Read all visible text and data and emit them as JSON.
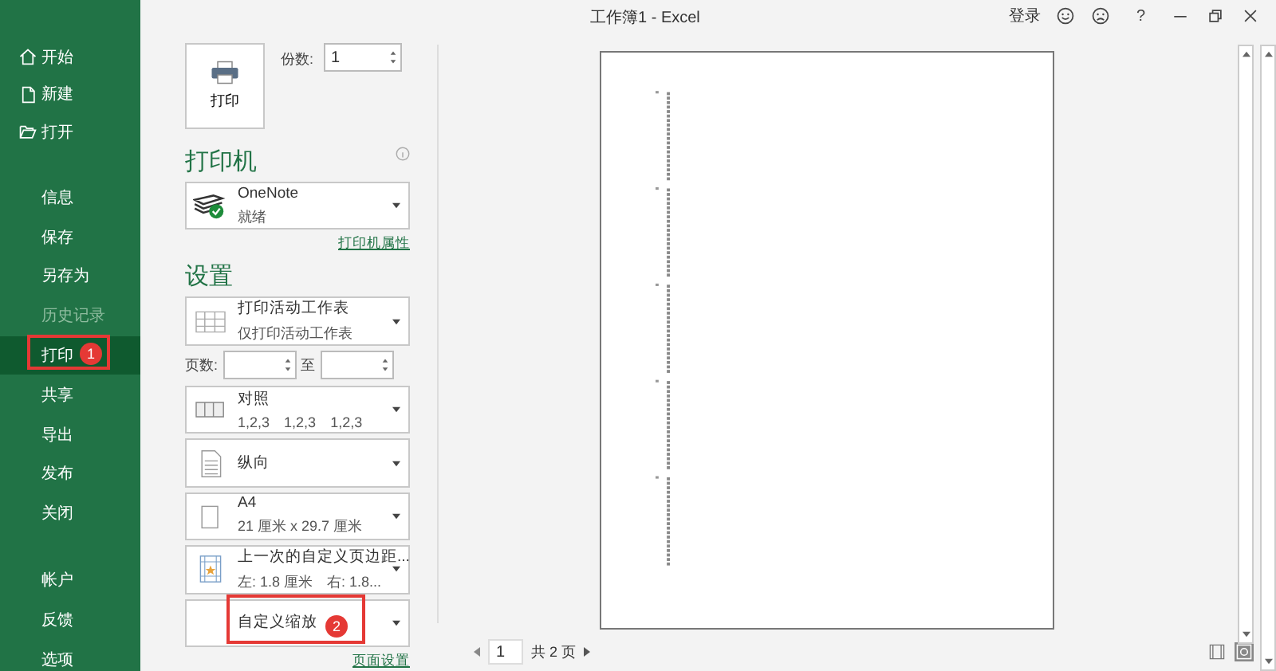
{
  "window": {
    "title": "工作簿1 - Excel",
    "sign_in": "登录",
    "help": "?"
  },
  "sidebar": {
    "items": [
      {
        "label": "开始",
        "selected": false,
        "disabled": false
      },
      {
        "label": "新建",
        "selected": false,
        "disabled": false
      },
      {
        "label": "打开",
        "selected": false,
        "disabled": false
      },
      {
        "label": "信息",
        "selected": false,
        "disabled": false
      },
      {
        "label": "保存",
        "selected": false,
        "disabled": false
      },
      {
        "label": "另存为",
        "selected": false,
        "disabled": false
      },
      {
        "label": "历史记录",
        "selected": false,
        "disabled": true
      },
      {
        "label": "打印",
        "selected": true,
        "disabled": false,
        "callout": "1"
      },
      {
        "label": "共享",
        "selected": false,
        "disabled": false
      },
      {
        "label": "导出",
        "selected": false,
        "disabled": false
      },
      {
        "label": "发布",
        "selected": false,
        "disabled": false
      },
      {
        "label": "关闭",
        "selected": false,
        "disabled": false
      },
      {
        "label": "帐户",
        "selected": false,
        "disabled": false
      },
      {
        "label": "反馈",
        "selected": false,
        "disabled": false
      },
      {
        "label": "选项",
        "selected": false,
        "disabled": false
      }
    ]
  },
  "print": {
    "button": "打印",
    "copies_label": "份数:",
    "copies": "1"
  },
  "printer": {
    "heading": "打印机",
    "name": "OneNote",
    "status": "就绪",
    "properties_link": "打印机属性"
  },
  "settings": {
    "heading": "设置",
    "pages_label": "页数:",
    "to_label": "至",
    "page_setup_link": "页面设置",
    "dropdowns": [
      {
        "kind": "sheet",
        "title": "打印活动工作表",
        "subtitle": "仅打印活动工作表"
      },
      {
        "kind": "collate",
        "title": "对照",
        "parts": [
          "1,2,3",
          "1,2,3",
          "1,2,3"
        ]
      },
      {
        "kind": "portrait",
        "title": "纵向"
      },
      {
        "kind": "paper",
        "title": "A4",
        "subtitle": "21 厘米 x 29.7 厘米"
      },
      {
        "kind": "margins",
        "title": "上一次的自定义页边距...",
        "parts": [
          "左:  1.8 厘米",
          "右:  1.8..."
        ]
      },
      {
        "kind": "blank",
        "title": "自定义缩放",
        "callout": "2"
      }
    ]
  },
  "preview": {
    "page": "1",
    "page_count": "共 2 页"
  }
}
